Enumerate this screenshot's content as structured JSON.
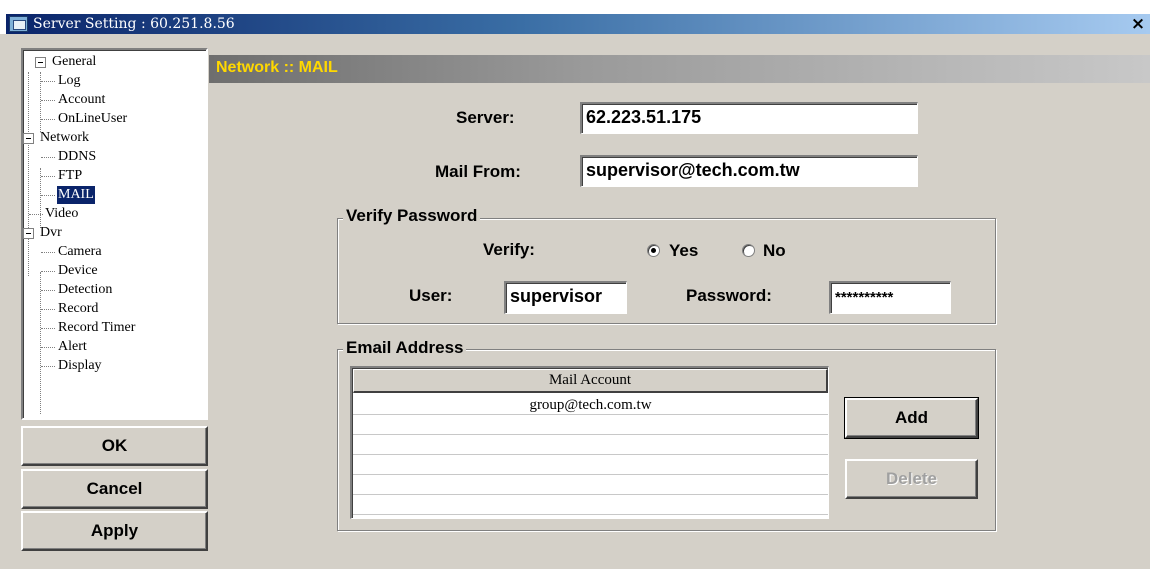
{
  "window": {
    "title": "Server Setting : 60.251.8.56",
    "close_glyph": "×"
  },
  "tree": {
    "items": [
      {
        "label": "General"
      },
      {
        "label": "Log"
      },
      {
        "label": "Account"
      },
      {
        "label": "OnLineUser"
      },
      {
        "label": "Network"
      },
      {
        "label": "DDNS"
      },
      {
        "label": "FTP"
      },
      {
        "label": "MAIL",
        "selected": true
      },
      {
        "label": "Video"
      },
      {
        "label": "Dvr"
      },
      {
        "label": "Camera"
      },
      {
        "label": "Device"
      },
      {
        "label": "Detection"
      },
      {
        "label": "Record"
      },
      {
        "label": "Record Timer"
      },
      {
        "label": "Alert"
      },
      {
        "label": "Display"
      }
    ]
  },
  "buttons": {
    "ok": "OK",
    "cancel": "Cancel",
    "apply": "Apply"
  },
  "panel": {
    "title": "Network :: MAIL",
    "server_label": "Server:",
    "server_value": "62.223.51.175",
    "mail_from_label": "Mail From:",
    "mail_from_value": "supervisor@tech.com.tw",
    "verify_group": {
      "title": "Verify Password",
      "verify_label": "Verify:",
      "options": [
        "Yes",
        "No"
      ],
      "selected": "Yes",
      "user_label": "User:",
      "user_value": "supervisor",
      "password_label": "Password:",
      "password_value": "**********"
    },
    "email_group": {
      "title": "Email Address",
      "column_header": "Mail Account",
      "rows": [
        "group@tech.com.tw",
        "",
        "",
        "",
        "",
        "",
        ""
      ],
      "add_label": "Add",
      "delete_label": "Delete"
    }
  },
  "colors": {
    "title_bar": "#0a246a",
    "header_text": "#ffd800",
    "face": "#d4d0c8",
    "selection": "#0a246a"
  },
  "icons": [
    "app-icon",
    "close-icon",
    "expand-minus-icon"
  ]
}
